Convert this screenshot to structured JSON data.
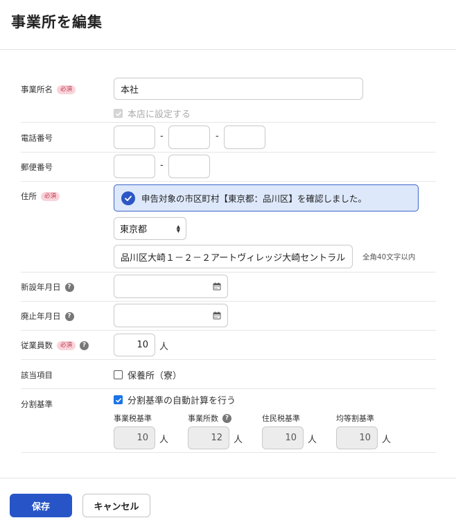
{
  "header": {
    "title": "事業所を編集"
  },
  "form": {
    "office_name": {
      "label": "事業所名",
      "required": "必須",
      "value": "本社",
      "head_office_checkbox": "本店に設定する"
    },
    "phone": {
      "label": "電話番号",
      "part1": "",
      "part2": "",
      "part3": "",
      "separator": "-"
    },
    "postal": {
      "label": "郵便番号",
      "part1": "",
      "part2": "",
      "separator": "-"
    },
    "address": {
      "label": "住所",
      "required": "必須",
      "notice": "申告対象の市区町村【東京都：品川区】を確認しました。",
      "prefecture": "東京都",
      "street": "品川区大崎１－２－２アートヴィレッジ大崎セントラル",
      "hint": "全角40文字以内"
    },
    "established": {
      "label": "新設年月日",
      "value": ""
    },
    "abolished": {
      "label": "廃止年月日",
      "value": ""
    },
    "employees": {
      "label": "従業員数",
      "required": "必須",
      "value": "10",
      "unit": "人"
    },
    "applicable": {
      "label": "該当項目",
      "checkbox": "保養所（寮）",
      "checked": false
    },
    "division": {
      "label": "分割基準",
      "auto_checkbox": "分割基準の自動計算を行う",
      "checked": true,
      "items": [
        {
          "label": "事業税基準",
          "value": "10",
          "unit": "人"
        },
        {
          "label": "事業所数",
          "value": "12",
          "unit": "人"
        },
        {
          "label": "住民税基準",
          "value": "10",
          "unit": "人"
        },
        {
          "label": "均等割基準",
          "value": "10",
          "unit": "人"
        }
      ]
    }
  },
  "footer": {
    "save": "保存",
    "cancel": "キャンセル"
  },
  "icons": {
    "help": "help-icon",
    "calendar": "calendar-icon",
    "check": "check-circle-icon"
  },
  "colors": {
    "primary": "#2755c7",
    "notice_bg": "#dde8fb",
    "required_bg": "#f9d4da"
  }
}
